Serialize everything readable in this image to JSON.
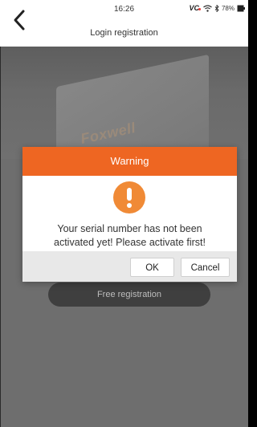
{
  "status_bar": {
    "time": "16:26",
    "vci_label": "VC",
    "vci_dot_color": "#e53935",
    "battery": "78%"
  },
  "header": {
    "title": "Login registration"
  },
  "hero": {
    "brand_logo": "Foxwell"
  },
  "free_registration_label": "Free registration",
  "dialog": {
    "title": "Warning",
    "accent_color": "#ee6622",
    "icon": "exclamation-icon",
    "message_line1": "Your serial number has not been",
    "message_line2": "activated yet! Please activate first!",
    "ok_label": "OK",
    "cancel_label": "Cancel"
  }
}
